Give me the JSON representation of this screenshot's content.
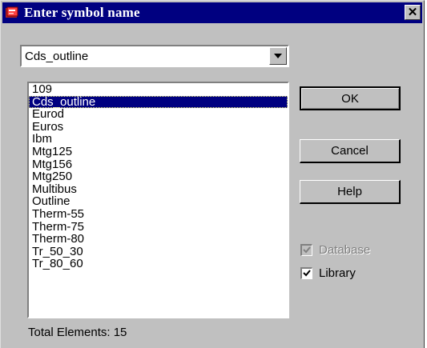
{
  "window": {
    "title": "Enter symbol name",
    "close_glyph": "✕"
  },
  "combo": {
    "value": "Cds_outline"
  },
  "list": {
    "items": [
      "109",
      "Cds_outline",
      "Eurod",
      "Euros",
      "Ibm",
      "Mtg125",
      "Mtg156",
      "Mtg250",
      "Multibus",
      "Outline",
      "Therm-55",
      "Therm-75",
      "Therm-80",
      "Tr_50_30",
      "Tr_80_60"
    ],
    "selected_index": 1
  },
  "buttons": {
    "ok": "OK",
    "cancel": "Cancel",
    "help": "Help"
  },
  "checks": {
    "database": {
      "label": "Database",
      "checked": true,
      "enabled": false
    },
    "library": {
      "label": "Library",
      "checked": true,
      "enabled": true
    }
  },
  "status": {
    "total": "Total Elements: 15"
  },
  "colors": {
    "titlebar": "#000080",
    "face": "#c0c0c0",
    "selection": "#000080"
  },
  "icons": {
    "app": "book-icon",
    "close": "close-icon",
    "dropdown": "chevron-down-icon",
    "check": "check-icon"
  }
}
